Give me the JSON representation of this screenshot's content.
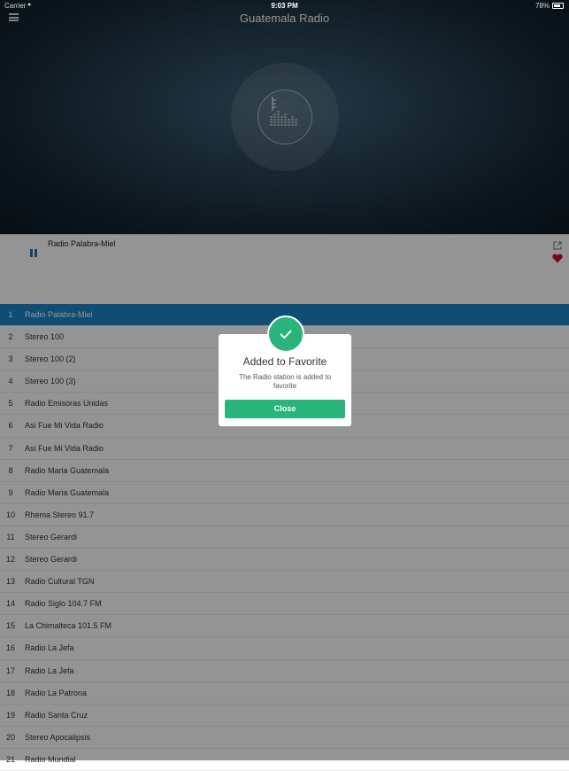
{
  "status_bar": {
    "carrier": "Carrier",
    "time": "9:03 PM",
    "battery": "78%"
  },
  "header": {
    "title": "Guatemala Radio"
  },
  "player": {
    "station_name": "Radio Palabra-Miel",
    "is_playing": true,
    "is_favorite": true
  },
  "stations": [
    {
      "num": "1",
      "name": "Radio Palabra-Miel",
      "active": true
    },
    {
      "num": "2",
      "name": "Stereo 100"
    },
    {
      "num": "3",
      "name": "Stereo 100 (2)"
    },
    {
      "num": "4",
      "name": "Stereo 100 (3)"
    },
    {
      "num": "5",
      "name": "Radio Emisoras Unidas"
    },
    {
      "num": "6",
      "name": "Asi Fue Mi Vida Radio"
    },
    {
      "num": "7",
      "name": "Asi Fue Mi Vida Radio"
    },
    {
      "num": "8",
      "name": "Radio Maria Guatemala"
    },
    {
      "num": "9",
      "name": "Radio Maria Guatemala"
    },
    {
      "num": "10",
      "name": "Rhema Stereo 91.7"
    },
    {
      "num": "11",
      "name": "Stereo Gerardi"
    },
    {
      "num": "12",
      "name": "Stereo Gerardi"
    },
    {
      "num": "13",
      "name": "Radio Cultural TGN"
    },
    {
      "num": "14",
      "name": "Radio Siglo 104.7 FM"
    },
    {
      "num": "15",
      "name": "La Chimalteca 101.5 FM"
    },
    {
      "num": "16",
      "name": "Radio La Jefa"
    },
    {
      "num": "17",
      "name": "Radio La Jefa"
    },
    {
      "num": "18",
      "name": "Radio La Patrona"
    },
    {
      "num": "19",
      "name": "Radio Santa Cruz"
    },
    {
      "num": "20",
      "name": "Stereo Apocalipsis"
    },
    {
      "num": "21",
      "name": "Radio Mundial"
    }
  ],
  "dialog": {
    "title": "Added to Favorite",
    "message": "The Radio station is added to favorite",
    "close_label": "Close"
  },
  "colors": {
    "accent_blue": "#1a85c9",
    "success_green": "#28b47b",
    "heart_red": "#c8102e"
  }
}
